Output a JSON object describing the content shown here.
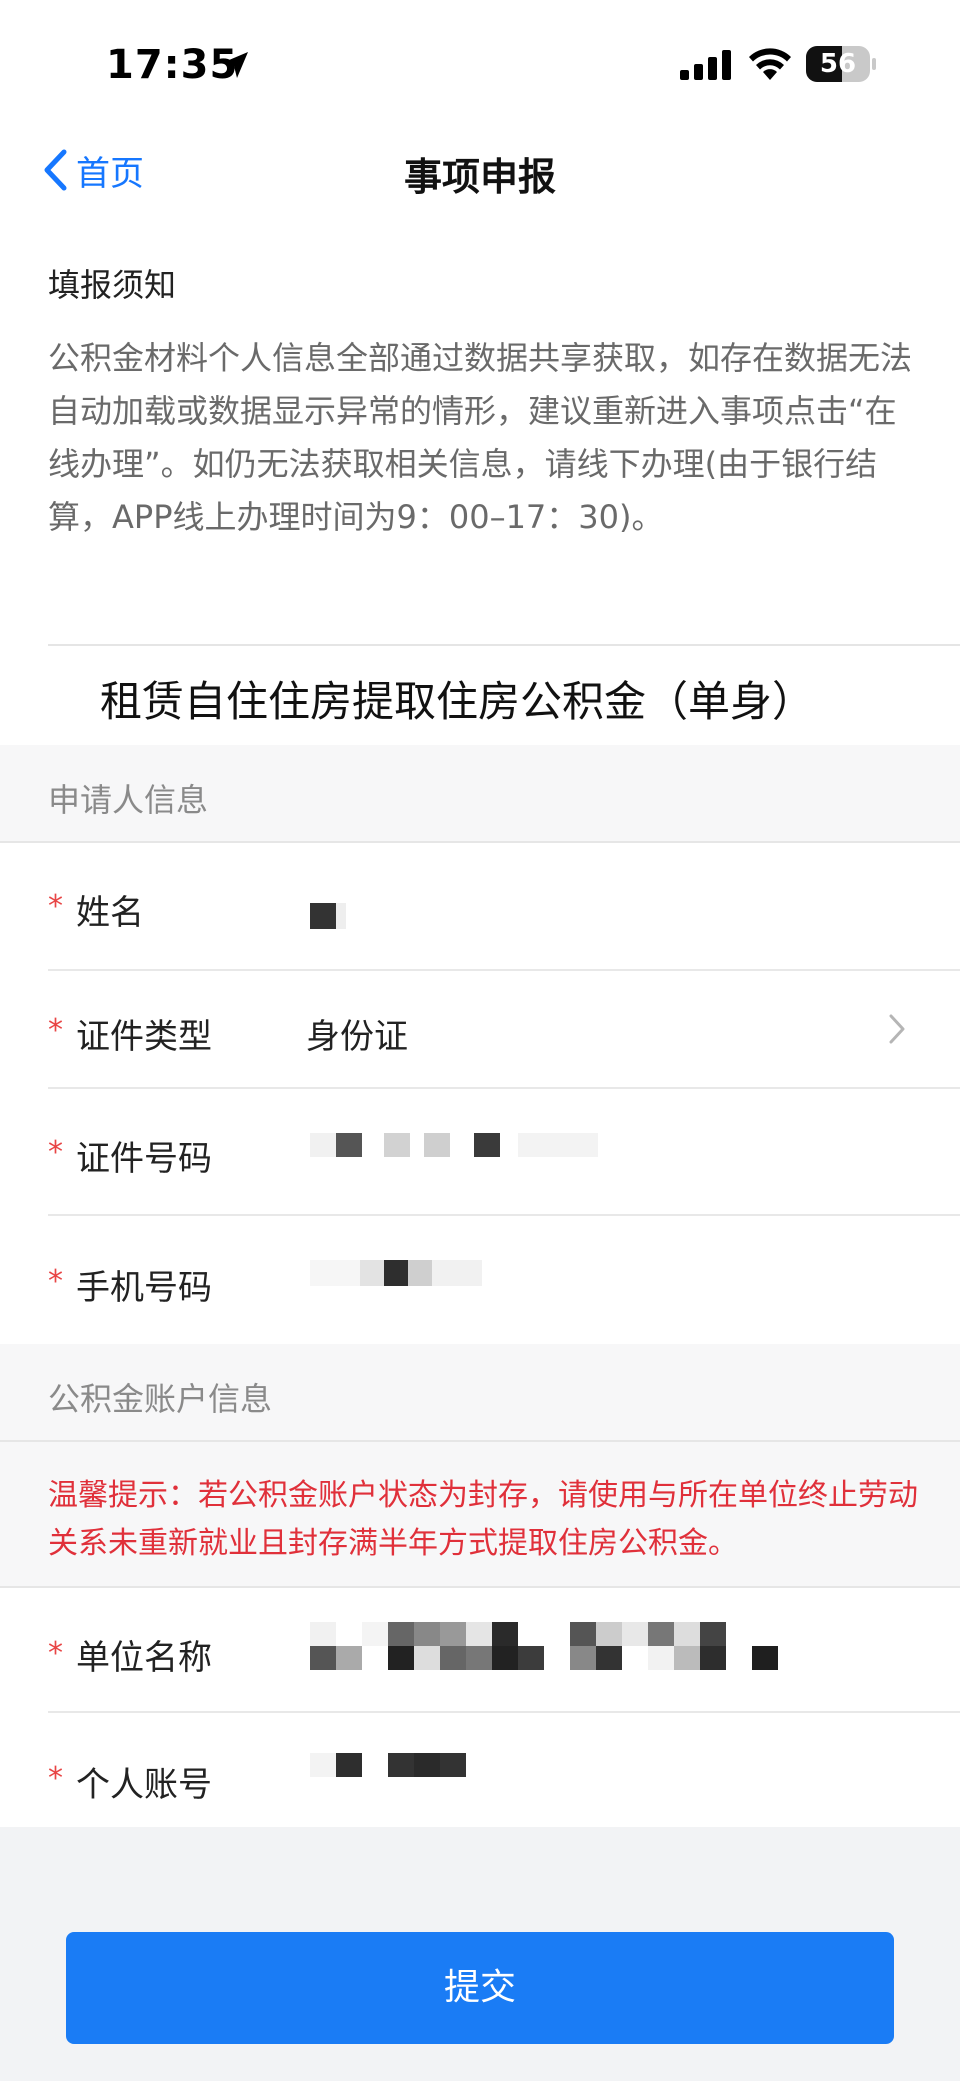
{
  "status_bar": {
    "time": "17:35",
    "battery": "56",
    "battery_level": 0.56,
    "icons": [
      "location-arrow-icon",
      "signal-icon",
      "wifi-icon",
      "battery-icon"
    ]
  },
  "nav": {
    "back_label": "首页",
    "title": "事项申报"
  },
  "notice": {
    "title": "填报须知",
    "body": "公积金材料个人信息全部通过数据共享获取，如存在数据无法自动加载或数据显示异常的情形，建议重新进入事项点击“在线办理”。如仍无法获取相关信息，请线下办理(由于银行结算，APP线上办理时间为9：00–17：30)。"
  },
  "matter_title": "租赁自住住房提取住房公积金（单身）",
  "applicant_section": {
    "header": "申请人信息",
    "fields": {
      "name": {
        "label": "姓名",
        "required_mark": "*"
      },
      "id_type": {
        "label": "证件类型",
        "value": "身份证",
        "required_mark": "*"
      },
      "id_number": {
        "label": "证件号码",
        "required_mark": "*"
      },
      "phone": {
        "label": "手机号码",
        "required_mark": "*"
      }
    }
  },
  "account_section": {
    "header": "公积金账户信息",
    "tip": "温馨提示：若公积金账户状态为封存，请使用与所在单位终止劳动关系未重新就业且封存满半年方式提取住房公积金。",
    "fields": {
      "company": {
        "label": "单位名称",
        "required_mark": "*"
      },
      "account": {
        "label": "个人账号",
        "required_mark": "*"
      }
    }
  },
  "submit_label": "提交",
  "colors": {
    "accent": "#1a7cf5",
    "required": "#e84545",
    "tip": "#e0303a"
  }
}
